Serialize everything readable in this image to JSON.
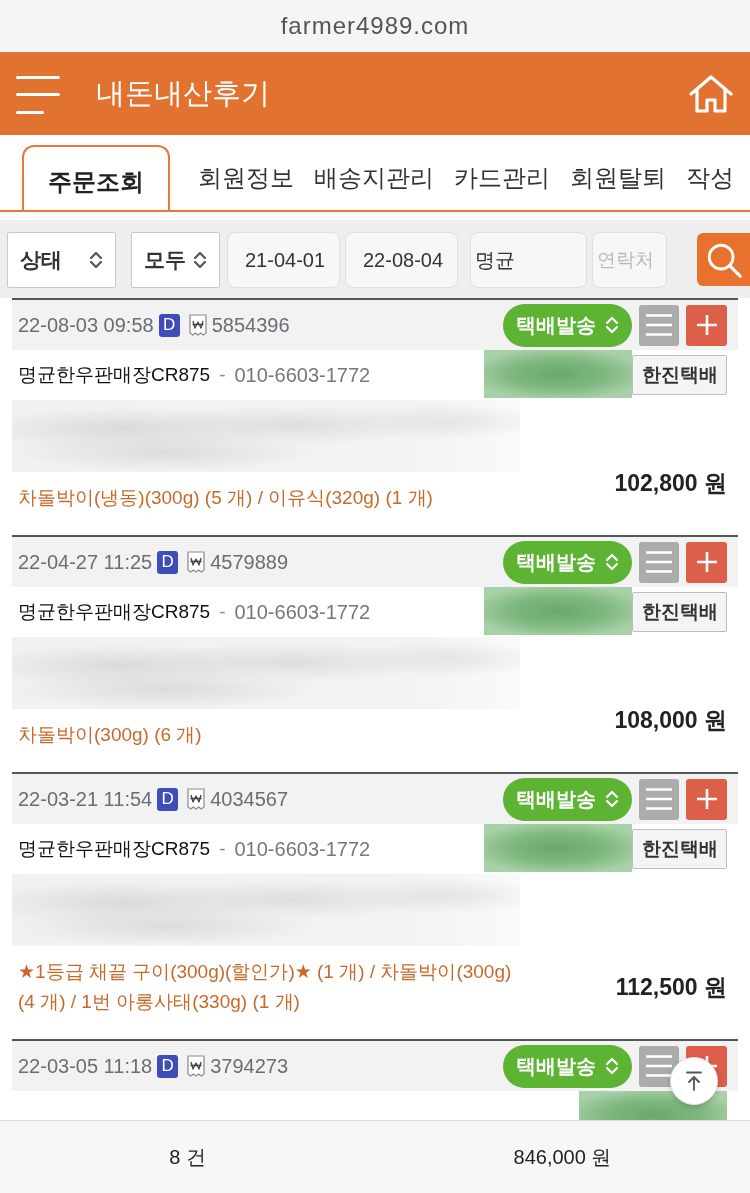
{
  "browser": {
    "url": "farmer4989.com"
  },
  "header": {
    "title": "내돈내산후기"
  },
  "tabs": [
    {
      "label": "주문조회",
      "selected": true
    },
    {
      "label": "회원정보",
      "selected": false
    },
    {
      "label": "배송지관리",
      "selected": false
    },
    {
      "label": "카드관리",
      "selected": false
    },
    {
      "label": "회원탈퇴",
      "selected": false
    },
    {
      "label": "작성",
      "selected": false
    }
  ],
  "filters": {
    "status": "상태",
    "scope": "모두",
    "date_from": "21-04-01",
    "date_to": "22-08-04",
    "name": "명균",
    "contact_placeholder": "연락처"
  },
  "orders": [
    {
      "datetime": "22-08-03 09:58",
      "badge": "D",
      "order_no": "5854396",
      "status": "택배발송",
      "store": "명균한우판매장CR875",
      "separator": "-",
      "phone": "010-6603-1772",
      "courier": "한진택배",
      "items": "차돌박이(냉동)(300g) (5 개) / 이유식(320g) (1 개)",
      "total": "102,800 원"
    },
    {
      "datetime": "22-04-27 11:25",
      "badge": "D",
      "order_no": "4579889",
      "status": "택배발송",
      "store": "명균한우판매장CR875",
      "separator": "-",
      "phone": "010-6603-1772",
      "courier": "한진택배",
      "items": "차돌박이(300g) (6 개)",
      "total": "108,000 원"
    },
    {
      "datetime": "22-03-21 11:54",
      "badge": "D",
      "order_no": "4034567",
      "status": "택배발송",
      "store": "명균한우판매장CR875",
      "separator": "-",
      "phone": "010-6603-1772",
      "courier": "한진택배",
      "items": "★1등급 채끝 구이(300g)(할인가)★ (1 개) / 차돌박이(300g) (4 개) / 1번 아롱사태(330g) (1 개)",
      "total": "112,500 원"
    },
    {
      "datetime": "22-03-05 11:18",
      "badge": "D",
      "order_no": "3794273",
      "status": "택배발송"
    }
  ],
  "summary": {
    "count": "8 건",
    "total": "846,000 원"
  }
}
